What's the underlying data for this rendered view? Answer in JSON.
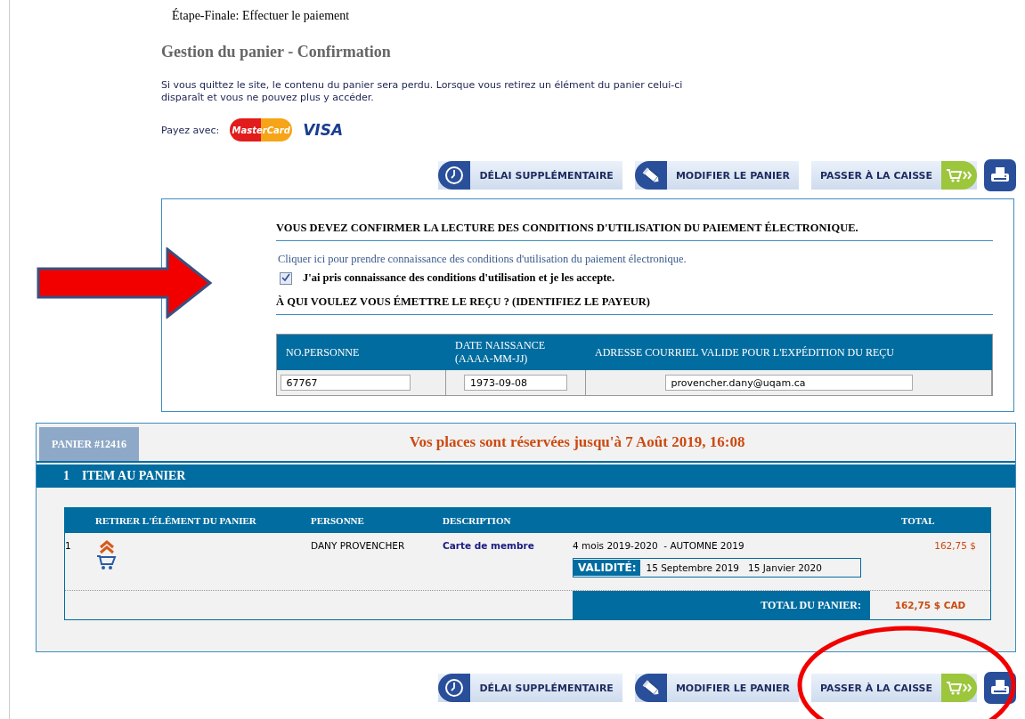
{
  "header": {
    "step": "Étape-Finale: Effectuer le paiement",
    "title": "Gestion du panier - Confirmation",
    "notice": "Si vous quittez le site, le contenu du panier sera perdu. Lorsque vous retirez un élément du panier celui-ci disparaît et vous ne pouvez plus y accéder.",
    "pay_with": "Payez avec:",
    "cards": [
      "MasterCard",
      "VISA"
    ]
  },
  "toolbar_top": [
    {
      "kind": "clock",
      "label": "DÉLAI SUPPLÉMENTAIRE"
    },
    {
      "kind": "pencil",
      "label": "MODIFIER LE PANIER"
    },
    {
      "kind": "checkout",
      "label": "PASSER À LA CAISSE"
    },
    {
      "kind": "print"
    }
  ],
  "confirmation": {
    "heading": "VOUS DEVEZ CONFIRMER LA LECTURE DES CONDITIONS D'UTILISATION DU PAIEMENT ÉLECTRONIQUE.",
    "link": "Cliquer ici pour prendre connaissance des conditions d'utilisation du paiement électronique.",
    "accept": {
      "label": "J'ai pris connaissance des conditions d'utilisation et je les accepte.",
      "checked": true
    },
    "payer_heading": "À QUI VOULEZ VOUS ÉMETTRE LE REÇU ? (IDENTIFIEZ LE PAYEUR)",
    "payer_table": {
      "columns": [
        "NO.PERSONNE",
        "DATE NAISSANCE (AAAA-MM-JJ)",
        "ADRESSE COURRIEL VALIDE POUR L'EXPÉDITION DU REÇU"
      ],
      "values": [
        "67767",
        "1973-09-08",
        "provencher.dany@uqam.ca"
      ]
    }
  },
  "cart": {
    "tab": "PANIER #12416",
    "reservation": "Vos places sont réservées jusqu'à 7 Août 2019, 16:08",
    "count": "1",
    "count_label": "ITEM AU PANIER",
    "columns": {
      "remove": "RETIRER L'ÉLÉMENT DU PANIER",
      "person": "PERSONNE",
      "description": "DESCRIPTION",
      "total": "TOTAL"
    },
    "rows": [
      {
        "index": "1",
        "person": "DANY PROVENCHER",
        "description": "Carte de membre",
        "details": "4 mois 2019-2020  - AUTOMNE 2019",
        "validity_label": "VALIDITÉ:",
        "validity_start": "15 Septembre 2019",
        "validity_end": "15 Janvier 2020",
        "total": "162,75 $"
      }
    ],
    "total_label": "TOTAL DU PANIER:",
    "total": "162,75 $ CAD"
  },
  "toolbar_bottom": [
    {
      "kind": "clock",
      "label": "DÉLAI SUPPLÉMENTAIRE"
    },
    {
      "kind": "pencil",
      "label": "MODIFIER LE PANIER"
    },
    {
      "kind": "checkout",
      "label": "PASSER À LA CAISSE"
    },
    {
      "kind": "print"
    }
  ]
}
